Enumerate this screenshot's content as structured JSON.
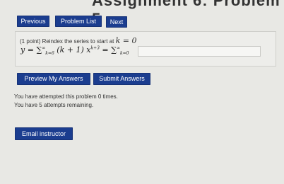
{
  "header": {
    "title": "Assignment 6: Problem 5"
  },
  "nav": {
    "previous_label": "Previous",
    "problem_list_label": "Problem List",
    "next_label": "Next"
  },
  "problem": {
    "prompt": "(1 point) Reindex the series to start at",
    "prompt_math": "k = 0",
    "eq_lhs": "y = ",
    "eq_sum1_upper": "∞",
    "eq_sum1_lower": "k=6",
    "eq_term": " (k + 1) x",
    "eq_term_exp": "k+3",
    "eq_mid": " = ",
    "eq_sum2_upper": "∞",
    "eq_sum2_lower": "k=0",
    "answer_value": ""
  },
  "actions": {
    "preview_label": "Preview My Answers",
    "submit_label": "Submit Answers"
  },
  "status": {
    "attempted": "You have attempted this problem 0 times.",
    "remaining": "You have 5 attempts remaining."
  },
  "footer": {
    "email_label": "Email instructor"
  }
}
